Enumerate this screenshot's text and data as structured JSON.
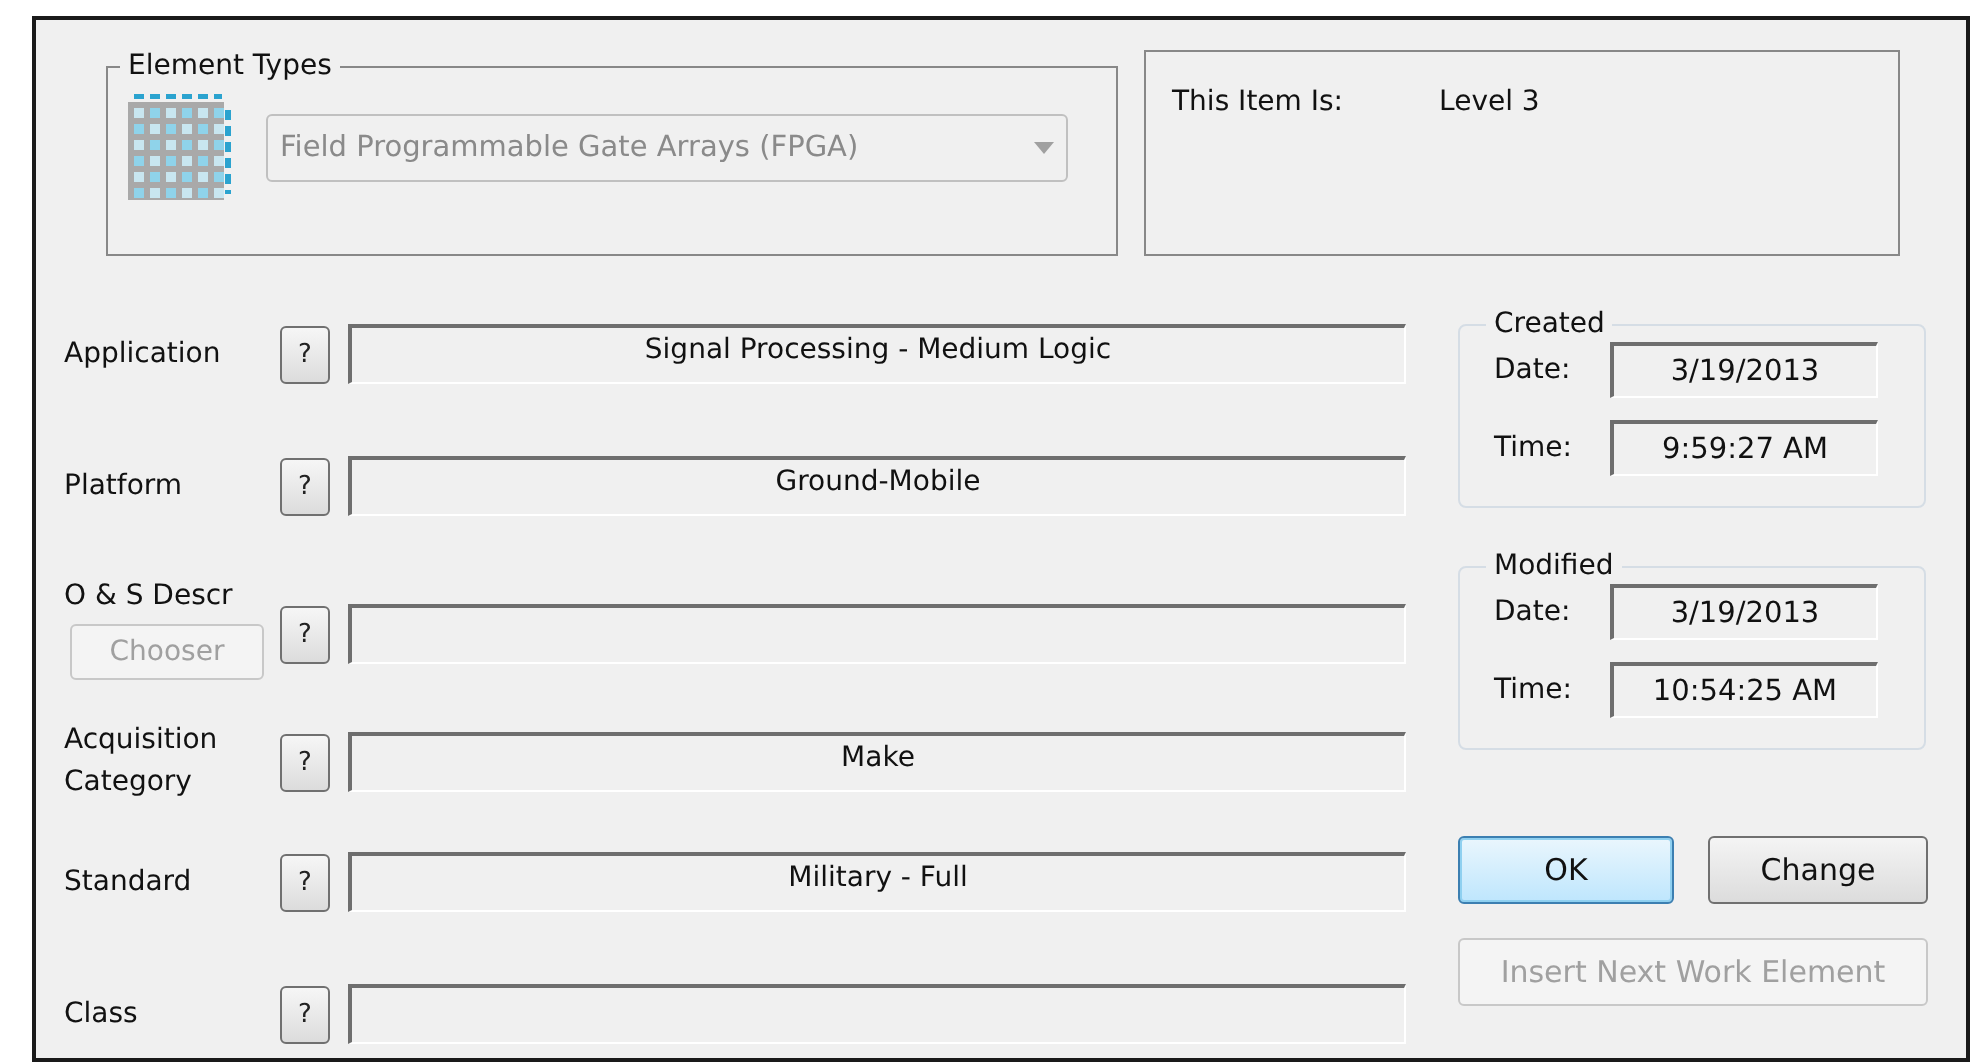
{
  "element_types": {
    "title": "Element Types",
    "dropdown": {
      "value": "Field Programmable Gate Arrays (FPGA)",
      "disabled": true
    }
  },
  "item_level": {
    "label": "This Item Is:",
    "value": "Level 3"
  },
  "fields": [
    {
      "label": "Application",
      "help": "?",
      "value": "Signal Processing - Medium Logic"
    },
    {
      "label": "Platform",
      "help": "?",
      "value": "Ground-Mobile"
    },
    {
      "label": "O & S Descr",
      "help": "?",
      "chooser": {
        "label": "Chooser",
        "disabled": true
      }
    },
    {
      "label": "Acquisition Category",
      "help": "?",
      "value": "Make"
    },
    {
      "label": "Standard",
      "help": "?",
      "value": "Military - Full"
    },
    {
      "label": "Class",
      "help": "?"
    }
  ],
  "created": {
    "title": "Created",
    "rows": [
      {
        "label": "Date:",
        "value": "3/19/2013"
      },
      {
        "label": "Time:",
        "value": "9:59:27 AM"
      }
    ]
  },
  "modified": {
    "title": "Modified",
    "rows": [
      {
        "label": "Date:",
        "value": "3/19/2013"
      },
      {
        "label": "Time:",
        "value": "10:54:25 AM"
      }
    ]
  },
  "buttons": [
    {
      "label": "OK",
      "default": true,
      "disabled": false
    },
    {
      "label": "Change",
      "default": false,
      "disabled": false
    },
    {
      "label": "Insert Next Work Element",
      "default": false,
      "disabled": true
    }
  ]
}
